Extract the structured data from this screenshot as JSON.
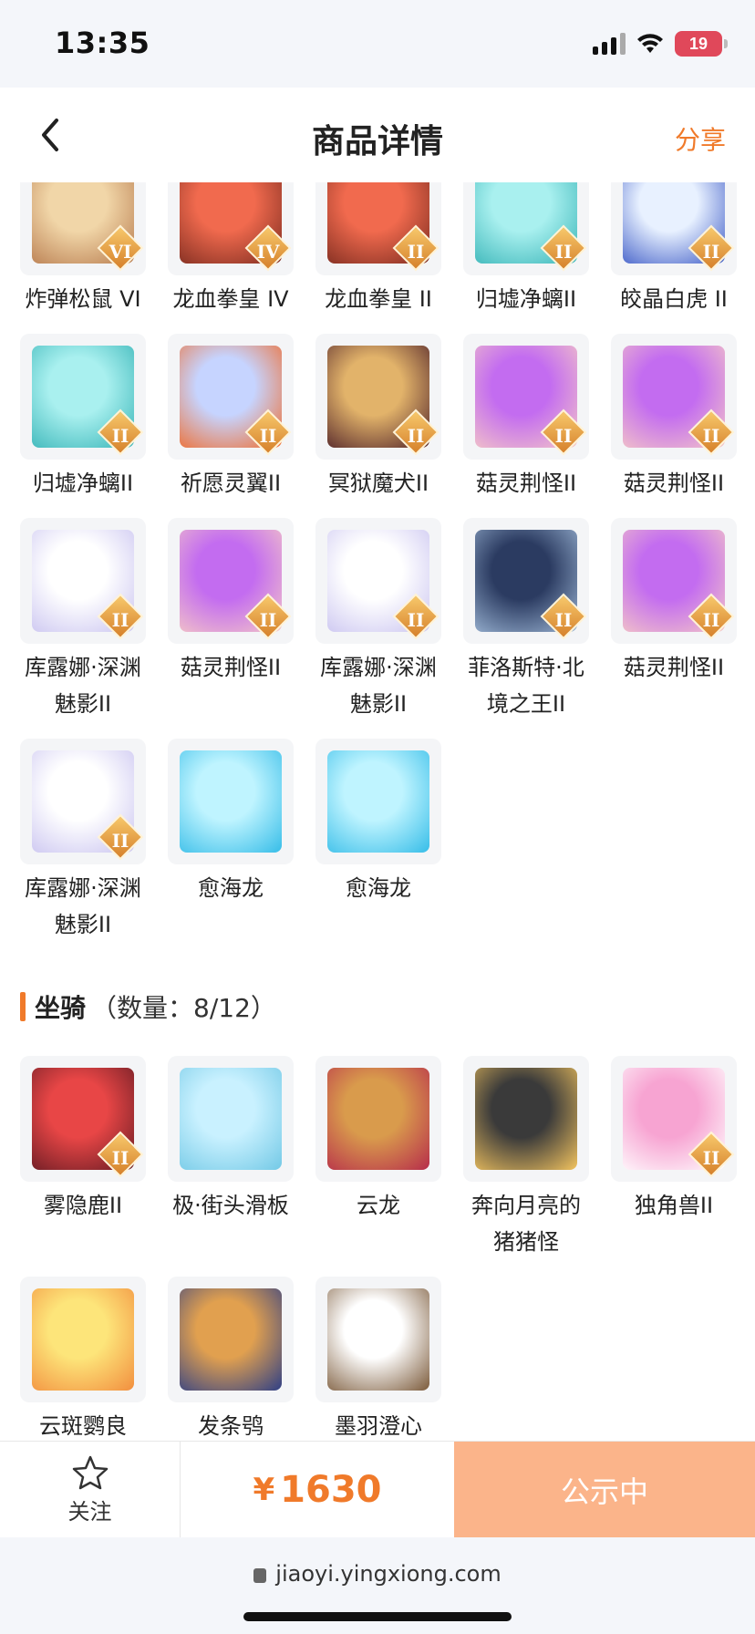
{
  "status": {
    "time": "13:35",
    "battery": "19"
  },
  "nav": {
    "title": "商品详情",
    "share": "分享"
  },
  "pets_grid": [
    {
      "name": "炸弹松鼠 VI",
      "grade": "VI",
      "colors": [
        "#f1d6a8",
        "#b77a4d"
      ]
    },
    {
      "name": "龙血拳皇 IV",
      "grade": "IV",
      "colors": [
        "#f16a4e",
        "#7a2b1f"
      ]
    },
    {
      "name": "龙血拳皇 II",
      "grade": "II",
      "colors": [
        "#f16a4e",
        "#7a2b1f"
      ]
    },
    {
      "name": "归墟净螭II",
      "grade": "II",
      "colors": [
        "#a9f0ef",
        "#37b4b7"
      ]
    },
    {
      "name": "皎晶白虎 II",
      "grade": "II",
      "colors": [
        "#e8f1ff",
        "#3b59c6"
      ]
    },
    {
      "name": "归墟净螭II",
      "grade": "II",
      "colors": [
        "#a9f0ef",
        "#37b4b7"
      ]
    },
    {
      "name": "祈愿灵翼II",
      "grade": "II",
      "colors": [
        "#c6d4ff",
        "#f06a2a"
      ]
    },
    {
      "name": "冥狱魔犬II",
      "grade": "II",
      "colors": [
        "#e2b36a",
        "#4d1f28"
      ]
    },
    {
      "name": "菇灵荆怪II",
      "grade": "II",
      "colors": [
        "#c36cf0",
        "#f5c9c5"
      ]
    },
    {
      "name": "菇灵荆怪II",
      "grade": "II",
      "colors": [
        "#c36cf0",
        "#f5c9c5"
      ]
    },
    {
      "name": "库露娜·深渊魅影II",
      "grade": "II",
      "colors": [
        "#ffffff",
        "#c9c3f0"
      ]
    },
    {
      "name": "菇灵荆怪II",
      "grade": "II",
      "colors": [
        "#c36cf0",
        "#f5c9c5"
      ]
    },
    {
      "name": "库露娜·深渊魅影II",
      "grade": "II",
      "colors": [
        "#ffffff",
        "#c9c3f0"
      ]
    },
    {
      "name": "菲洛斯特·北境之王II",
      "grade": "II",
      "colors": [
        "#2b3b61",
        "#9fb9d8"
      ]
    },
    {
      "name": "菇灵荆怪II",
      "grade": "II",
      "colors": [
        "#c36cf0",
        "#f5c9c5"
      ]
    },
    {
      "name": "库露娜·深渊魅影II",
      "grade": "II",
      "colors": [
        "#ffffff",
        "#c9c3f0"
      ]
    },
    {
      "name": "愈海龙",
      "grade": "",
      "colors": [
        "#bff4ff",
        "#36bde8"
      ]
    },
    {
      "name": "愈海龙",
      "grade": "",
      "colors": [
        "#bff4ff",
        "#36bde8"
      ]
    }
  ],
  "mounts_section": {
    "title": "坐骑",
    "count": "（数量：8/12）"
  },
  "mounts_grid": [
    {
      "name": "雾隐鹿II",
      "grade": "II",
      "colors": [
        "#e84646",
        "#651b23"
      ]
    },
    {
      "name": "极·街头滑板",
      "grade": "",
      "colors": [
        "#c9f1ff",
        "#73c9e6"
      ]
    },
    {
      "name": "云龙",
      "grade": "",
      "colors": [
        "#d99b4c",
        "#b62c4b"
      ]
    },
    {
      "name": "奔向月亮的猪猪怪",
      "grade": "",
      "colors": [
        "#3a3a3a",
        "#f3c45f"
      ]
    },
    {
      "name": "独角兽II",
      "grade": "II",
      "colors": [
        "#f7a4d2",
        "#ffffff"
      ]
    },
    {
      "name": "云斑鹦良",
      "grade": "",
      "colors": [
        "#fde57a",
        "#f28e3e"
      ]
    },
    {
      "name": "发条鸮",
      "grade": "",
      "colors": [
        "#e1a04f",
        "#2e3f86"
      ]
    },
    {
      "name": "墨羽澄心",
      "grade": "",
      "colors": [
        "#ffffff",
        "#7b5a3a"
      ]
    }
  ],
  "bottom": {
    "follow_label": "关注",
    "price_symbol": "¥",
    "price": "1630",
    "cta": "公示中"
  },
  "url": "jiaoyi.yingxiong.com"
}
